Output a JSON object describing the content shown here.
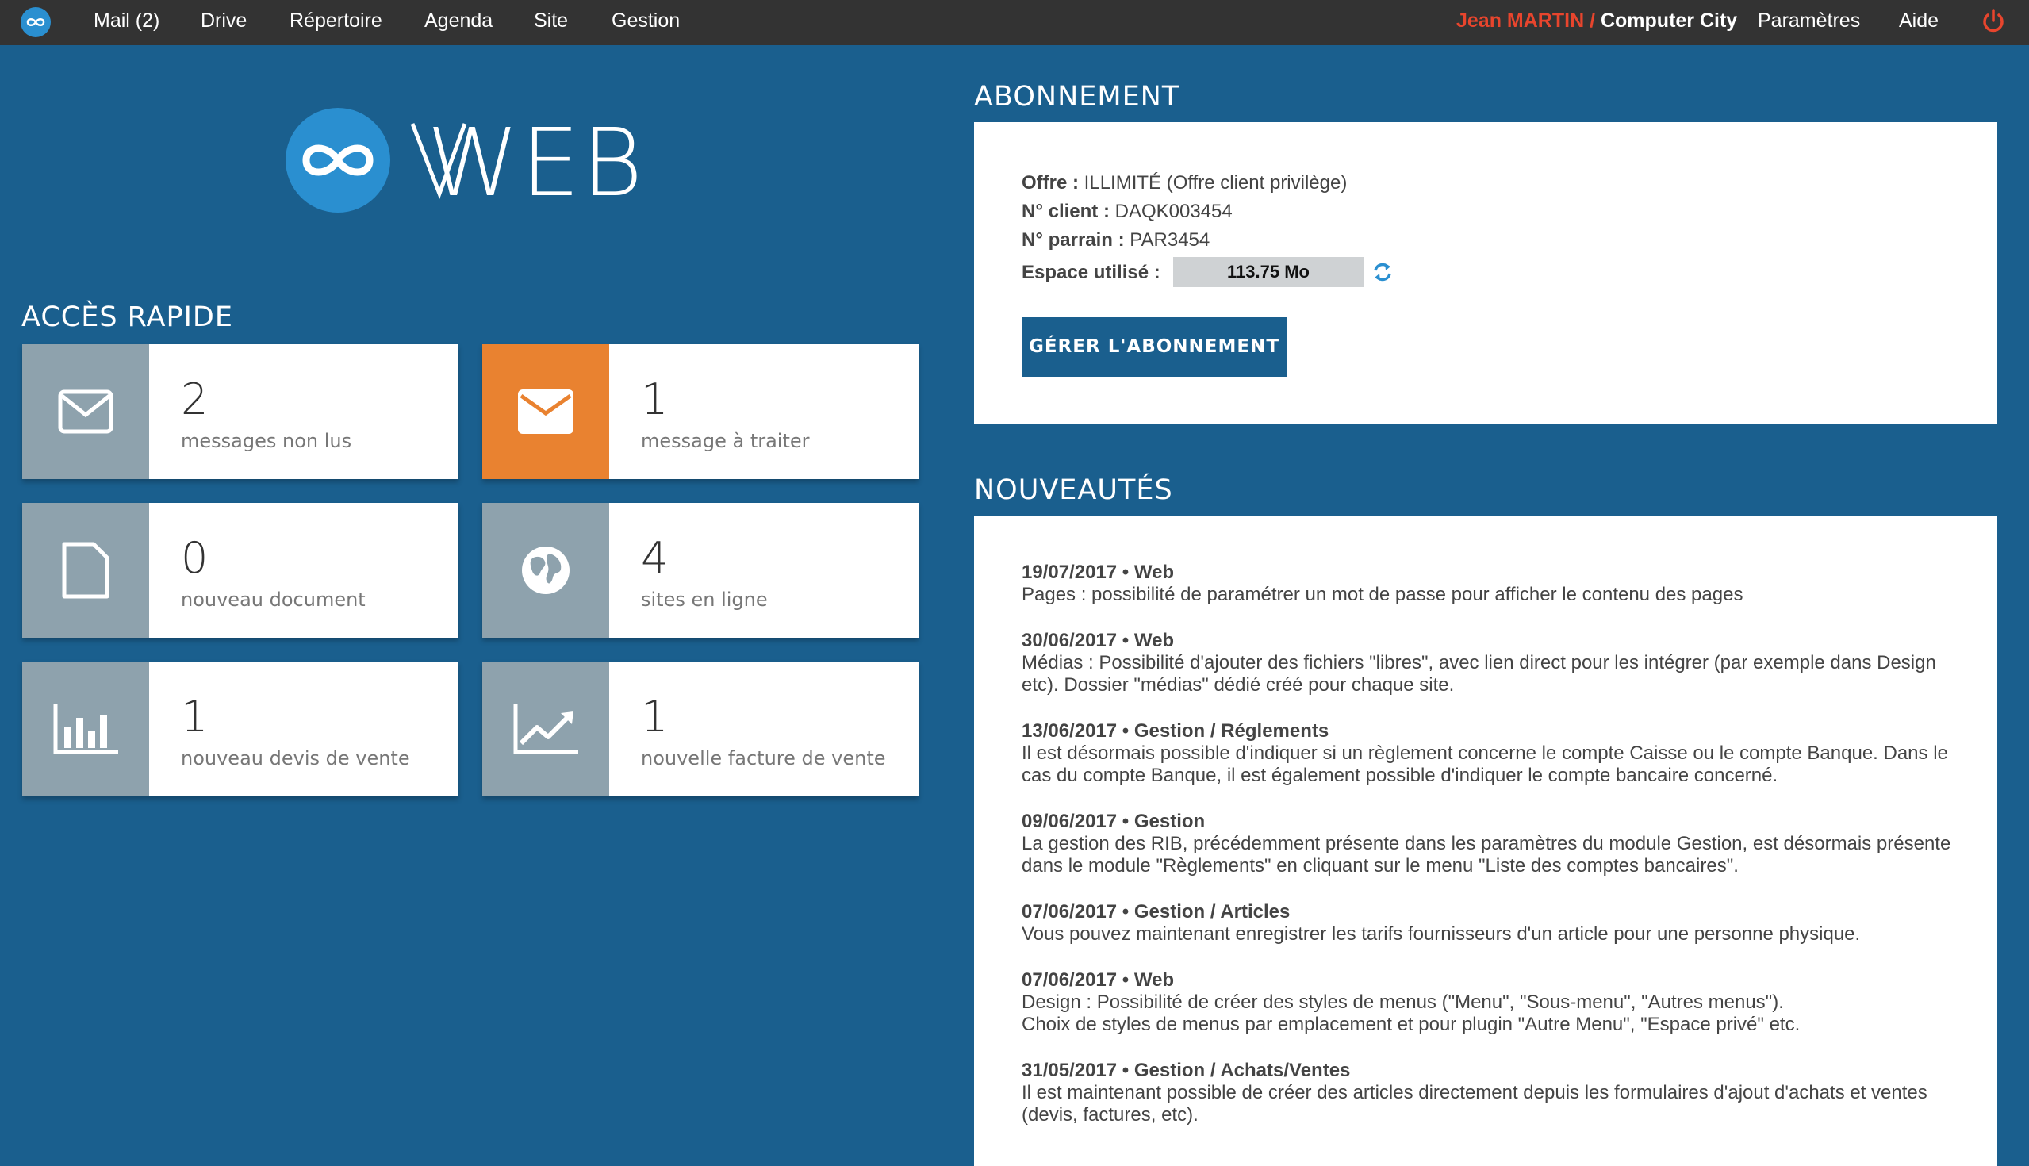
{
  "nav": {
    "mail": "Mail (2)",
    "drive": "Drive",
    "directory": "Répertoire",
    "agenda": "Agenda",
    "site": "Site",
    "management": "Gestion",
    "user": "Jean MARTIN /",
    "company": "Computer City",
    "settings": "Paramètres",
    "help": "Aide"
  },
  "brand": {
    "name": "WEB"
  },
  "quick_access": {
    "title": "ACCÈS RAPIDE",
    "tiles": [
      {
        "count": "2",
        "label": "messages non lus",
        "icon": "envelope-icon"
      },
      {
        "count": "1",
        "label": "message à traiter",
        "icon": "envelope-icon"
      },
      {
        "count": "0",
        "label": "nouveau document",
        "icon": "document-icon"
      },
      {
        "count": "4",
        "label": "sites en ligne",
        "icon": "globe-icon"
      },
      {
        "count": "1",
        "label": "nouveau devis de vente",
        "icon": "bar-chart-icon"
      },
      {
        "count": "1",
        "label": "nouvelle facture de vente",
        "icon": "trend-chart-icon"
      }
    ]
  },
  "subscription": {
    "title": "ABONNEMENT",
    "offer_label": "Offre :",
    "offer_value": "ILLIMITÉ (Offre client privilège)",
    "client_label": "N° client :",
    "client_value": "DAQK003454",
    "sponsor_label": "N° parrain :",
    "sponsor_value": "PAR3454",
    "space_label": "Espace utilisé :",
    "space_value": "113.75 Mo",
    "manage_button": "GÉRER L'ABONNEMENT"
  },
  "news": {
    "title": "NOUVEAUTÉS",
    "items": [
      {
        "head": "19/07/2017 • Web",
        "body": "Pages : possibilité de paramétrer un mot de passe pour afficher le contenu des pages"
      },
      {
        "head": "30/06/2017 • Web",
        "body": "Médias : Possibilité d'ajouter des fichiers \"libres\", avec lien direct pour les intégrer (par exemple dans Design etc). Dossier \"médias\" dédié créé pour chaque site."
      },
      {
        "head": "13/06/2017 • Gestion / Réglements",
        "body": "Il est désormais possible d'indiquer si un règlement concerne le compte Caisse ou le compte Banque. Dans le cas du compte Banque, il est également possible d'indiquer le compte bancaire concerné."
      },
      {
        "head": "09/06/2017 • Gestion",
        "body": "La gestion des RIB, précédemment présente dans les paramètres du module Gestion, est désormais présente dans le module \"Règlements\" en cliquant sur le menu \"Liste des comptes bancaires\"."
      },
      {
        "head": "07/06/2017 • Gestion / Articles",
        "body": "Vous pouvez maintenant enregistrer les tarifs fournisseurs d'un article pour une personne physique."
      },
      {
        "head": "07/06/2017 • Web",
        "body": "Design : Possibilité de créer des styles de menus (\"Menu\", \"Sous-menu\", \"Autres menus\").",
        "body2": "Choix de styles de menus par emplacement et pour plugin \"Autre Menu\", \"Espace privé\" etc."
      },
      {
        "head": "31/05/2017 • Gestion / Achats/Ventes",
        "body": "Il est maintenant possible de créer des articles directement depuis les formulaires d'ajout d'achats et ventes (devis, factures, etc)."
      }
    ]
  },
  "colors": {
    "background": "#1a5f8e",
    "topbar": "#333333",
    "tile_icon_gray": "#8ea2ad",
    "tile_icon_orange": "#e98230",
    "user_red": "#e8452d"
  }
}
